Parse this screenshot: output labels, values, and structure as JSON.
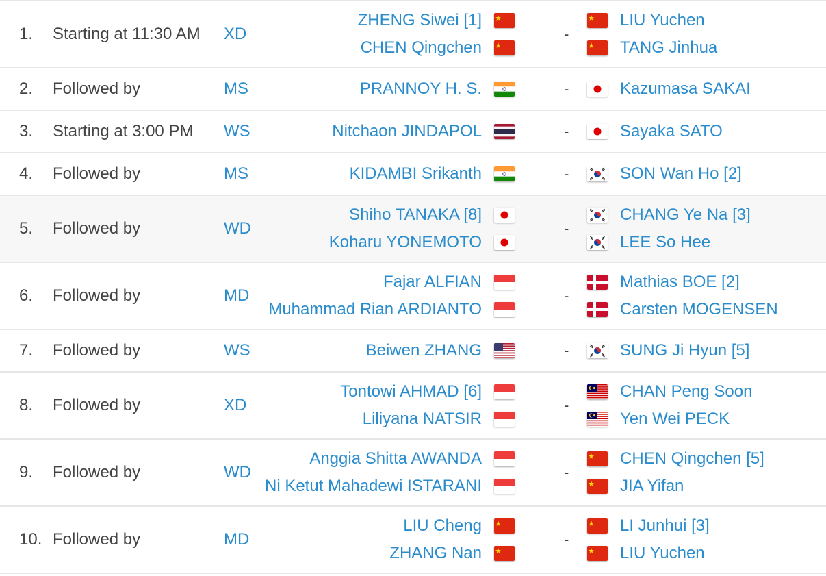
{
  "colors": {
    "link": "#2a8ccd",
    "text": "#444444",
    "divider": "#e6e6e6",
    "highlight_row": "#f7f7f7"
  },
  "matches": [
    {
      "num": "1.",
      "time": "Starting at 11:30 AM",
      "event": "XD",
      "team1": [
        {
          "name": "ZHENG Siwei [1]",
          "flag": "CHN"
        },
        {
          "name": "CHEN Qingchen",
          "flag": "CHN"
        }
      ],
      "team2": [
        {
          "name": "LIU Yuchen",
          "flag": "CHN"
        },
        {
          "name": "TANG Jinhua",
          "flag": "CHN"
        }
      ]
    },
    {
      "num": "2.",
      "time": "Followed by",
      "event": "MS",
      "team1": [
        {
          "name": "PRANNOY H. S.",
          "flag": "IND"
        }
      ],
      "team2": [
        {
          "name": "Kazumasa SAKAI",
          "flag": "JPN"
        }
      ]
    },
    {
      "num": "3.",
      "time": "Starting at 3:00 PM",
      "event": "WS",
      "team1": [
        {
          "name": "Nitchaon JINDAPOL",
          "flag": "THA"
        }
      ],
      "team2": [
        {
          "name": "Sayaka SATO",
          "flag": "JPN"
        }
      ]
    },
    {
      "num": "4.",
      "time": "Followed by",
      "event": "MS",
      "team1": [
        {
          "name": "KIDAMBI Srikanth",
          "flag": "IND"
        }
      ],
      "team2": [
        {
          "name": "SON Wan Ho [2]",
          "flag": "KOR"
        }
      ]
    },
    {
      "num": "5.",
      "time": "Followed by",
      "event": "WD",
      "team1": [
        {
          "name": "Shiho TANAKA [8]",
          "flag": "JPN"
        },
        {
          "name": "Koharu YONEMOTO",
          "flag": "JPN"
        }
      ],
      "team2": [
        {
          "name": "CHANG Ye Na [3]",
          "flag": "KOR"
        },
        {
          "name": "LEE So Hee",
          "flag": "KOR"
        }
      ]
    },
    {
      "num": "6.",
      "time": "Followed by",
      "event": "MD",
      "team1": [
        {
          "name": "Fajar ALFIAN",
          "flag": "INA"
        },
        {
          "name": "Muhammad Rian ARDIANTO",
          "flag": "INA"
        }
      ],
      "team2": [
        {
          "name": "Mathias BOE [2]",
          "flag": "DEN"
        },
        {
          "name": "Carsten MOGENSEN",
          "flag": "DEN"
        }
      ]
    },
    {
      "num": "7.",
      "time": "Followed by",
      "event": "WS",
      "team1": [
        {
          "name": "Beiwen ZHANG",
          "flag": "USA"
        }
      ],
      "team2": [
        {
          "name": "SUNG Ji Hyun [5]",
          "flag": "KOR"
        }
      ]
    },
    {
      "num": "8.",
      "time": "Followed by",
      "event": "XD",
      "team1": [
        {
          "name": "Tontowi AHMAD [6]",
          "flag": "INA"
        },
        {
          "name": "Liliyana NATSIR",
          "flag": "INA"
        }
      ],
      "team2": [
        {
          "name": "CHAN Peng Soon",
          "flag": "MAS"
        },
        {
          "name": "Yen Wei PECK",
          "flag": "MAS"
        }
      ]
    },
    {
      "num": "9.",
      "time": "Followed by",
      "event": "WD",
      "team1": [
        {
          "name": "Anggia Shitta AWANDA",
          "flag": "INA"
        },
        {
          "name": "Ni Ketut Mahadewi ISTARANI",
          "flag": "INA"
        }
      ],
      "team2": [
        {
          "name": "CHEN Qingchen [5]",
          "flag": "CHN"
        },
        {
          "name": "JIA Yifan",
          "flag": "CHN"
        }
      ]
    },
    {
      "num": "10.",
      "time": "Followed by",
      "event": "MD",
      "team1": [
        {
          "name": "LIU Cheng",
          "flag": "CHN"
        },
        {
          "name": "ZHANG Nan",
          "flag": "CHN"
        }
      ],
      "team2": [
        {
          "name": "LI Junhui [3]",
          "flag": "CHN"
        },
        {
          "name": "LIU Yuchen",
          "flag": "CHN"
        }
      ]
    }
  ],
  "separator": "-",
  "highlighted_match": "5."
}
